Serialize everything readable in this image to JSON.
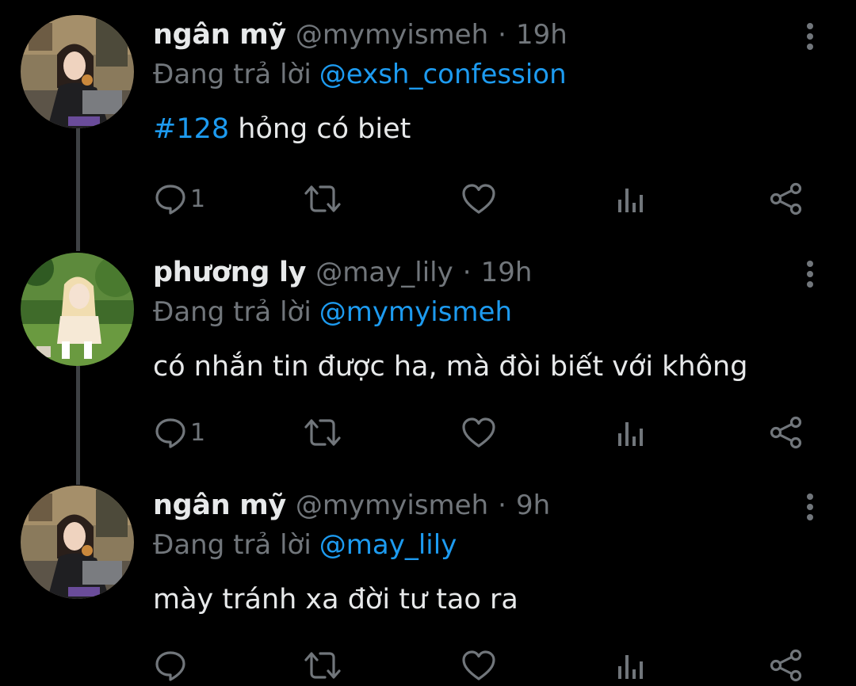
{
  "tweets": [
    {
      "display_name": "ngân mỹ",
      "handle": "@mymyismeh",
      "separator": "·",
      "time": "19h",
      "reply_prefix": "Đang trả lời",
      "reply_to": "@exsh_confession",
      "hashtag": "#128",
      "text": " hỏng có biet",
      "reply_count": "1",
      "avatar": "avatar-photo-woman-garden"
    },
    {
      "display_name": "phương ly",
      "handle": "@may_lily",
      "separator": "·",
      "time": "19h",
      "reply_prefix": "Đang trả lời",
      "reply_to": "@mymyismeh",
      "hashtag": "",
      "text": "có nhắn tin được ha, mà đòi biết với không",
      "reply_count": "1",
      "avatar": "avatar-photo-blonde-grass"
    },
    {
      "display_name": "ngân mỹ",
      "handle": "@mymyismeh",
      "separator": "·",
      "time": "9h",
      "reply_prefix": "Đang trả lời",
      "reply_to": "@may_lily",
      "hashtag": "",
      "text": "mày tránh xa đời tư tao ra",
      "reply_count": "",
      "avatar": "avatar-photo-woman-garden"
    }
  ],
  "icons": {
    "reply": "reply-icon",
    "retweet": "retweet-icon",
    "like": "heart-icon",
    "views": "analytics-icon",
    "share": "share-icon",
    "more": "more-vertical-icon"
  },
  "colors": {
    "background": "#000000",
    "text": "#e7e9ea",
    "secondary": "#71767b",
    "link": "#1d9bf0",
    "thread_line": "#3e4144"
  }
}
